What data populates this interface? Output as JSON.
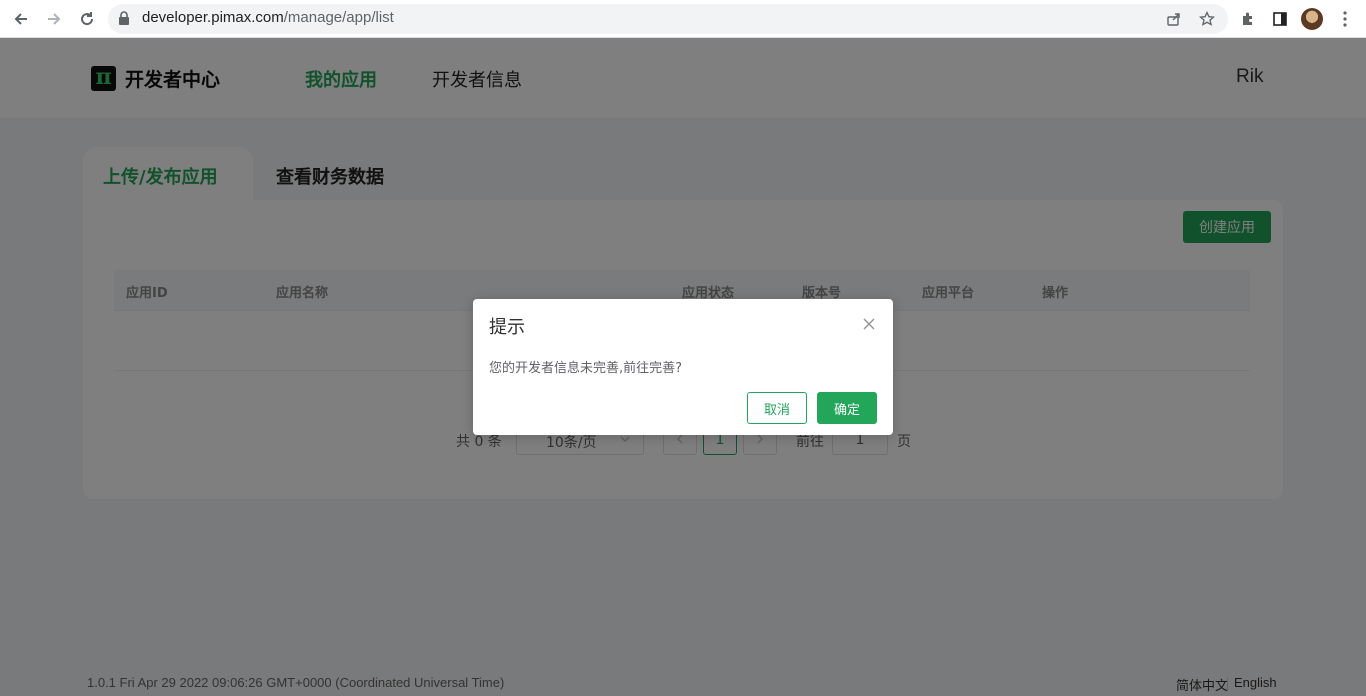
{
  "browser": {
    "url_domain": "developer.pimax.com",
    "url_path": "/manage/app/list",
    "icons": [
      "back-icon",
      "forward-icon",
      "reload-icon",
      "lock-icon",
      "share-icon",
      "star-icon",
      "extensions-icon",
      "side-panel-icon",
      "avatar",
      "menu-icon"
    ]
  },
  "header": {
    "logo_glyph": "π",
    "logo_text": "开发者中心",
    "nav": [
      {
        "label": "我的应用",
        "active": true
      },
      {
        "label": "开发者信息",
        "active": false
      }
    ],
    "user": "Rik"
  },
  "tabs": [
    {
      "label": "上传/发布应用",
      "active": true
    },
    {
      "label": "查看财务数据",
      "active": false
    }
  ],
  "toolbar": {
    "create_label": "创建应用"
  },
  "table": {
    "columns": [
      "应用ID",
      "应用名称",
      "应用状态",
      "版本号",
      "应用平台",
      "操作"
    ],
    "rows": []
  },
  "pagination": {
    "total_text": "共 0 条",
    "page_size": "10条/页",
    "current_page": "1",
    "goto_label": "前往",
    "goto_value": "1",
    "page_suffix": "页"
  },
  "footer": {
    "version": "1.0.1 Fri Apr 29 2022 09:06:26 GMT+0000 (Coordinated Universal Time)",
    "lang_zh": "简体中文",
    "lang_en": "English"
  },
  "dialog": {
    "title": "提示",
    "message": "您的开发者信息未完善,前往完善?",
    "cancel_label": "取消",
    "confirm_label": "确定"
  },
  "colors": {
    "accent": "#23a55a",
    "overlay": "rgba(0,0,0,0.5)"
  }
}
